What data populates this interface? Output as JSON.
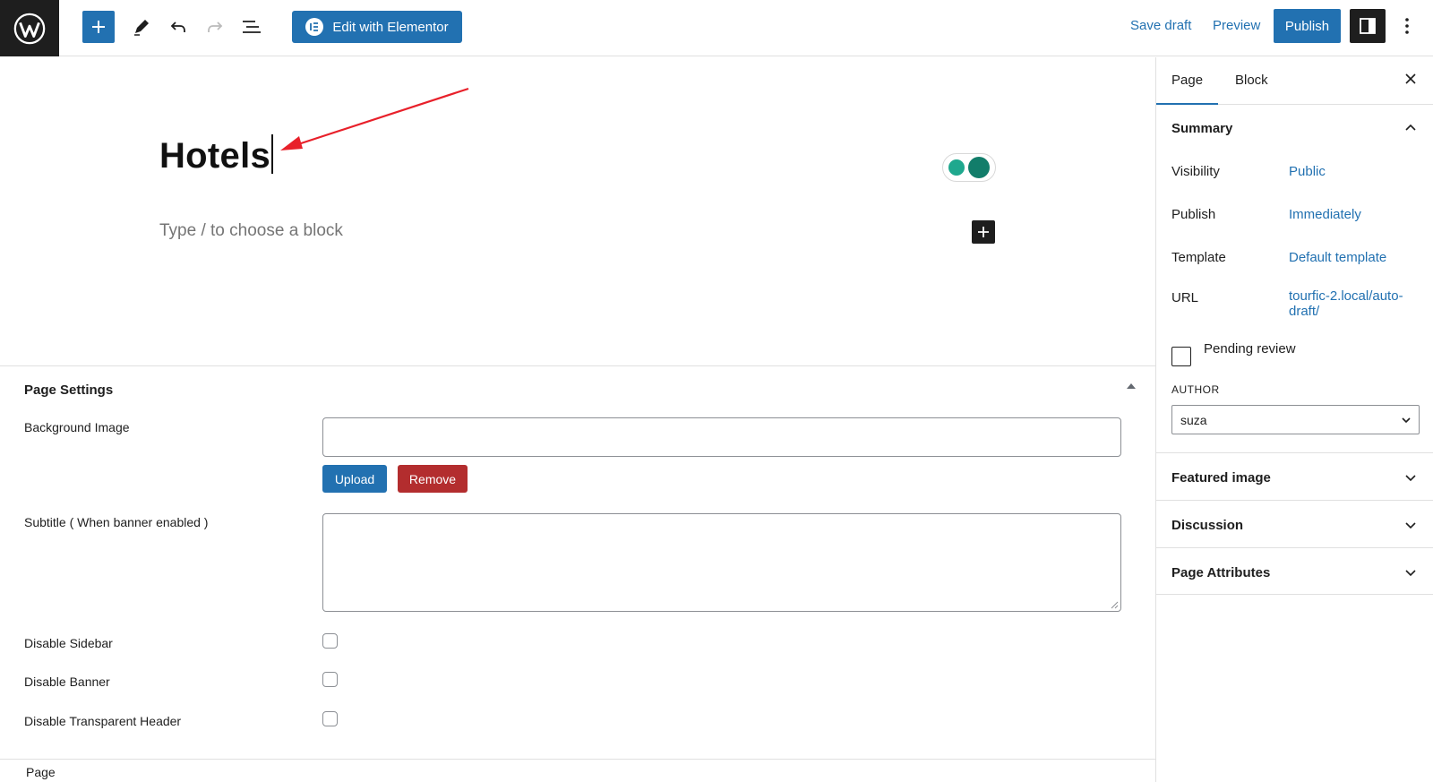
{
  "toolbar": {
    "elementor_label": "Edit with Elementor",
    "save_draft": "Save draft",
    "preview": "Preview",
    "publish": "Publish"
  },
  "editor": {
    "title": "Hotels",
    "placeholder": "Type / to choose a block"
  },
  "page_settings": {
    "title": "Page Settings",
    "background_image_label": "Background Image",
    "upload": "Upload",
    "remove": "Remove",
    "subtitle_label": "Subtitle ( When banner enabled )",
    "disable_sidebar": "Disable Sidebar",
    "disable_banner": "Disable Banner",
    "disable_transparent_header": "Disable Transparent Header"
  },
  "footer": {
    "breadcrumb": "Page"
  },
  "sidebar": {
    "tabs": [
      "Page",
      "Block"
    ],
    "summary": {
      "title": "Summary",
      "visibility_label": "Visibility",
      "visibility_value": "Public",
      "publish_label": "Publish",
      "publish_value": "Immediately",
      "template_label": "Template",
      "template_value": "Default template",
      "url_label": "URL",
      "url_value_line1": "tourfic-2.local/auto-",
      "url_value_line2": "draft/",
      "pending_review": "Pending review",
      "author_caption": "AUTHOR",
      "author_value": "suza"
    },
    "panels": [
      "Featured image",
      "Discussion",
      "Page Attributes"
    ]
  },
  "colors": {
    "accent": "#2271b1",
    "dark": "#1e1e1e",
    "danger": "#b32d2e",
    "annotation_arrow": "#e8202a"
  }
}
